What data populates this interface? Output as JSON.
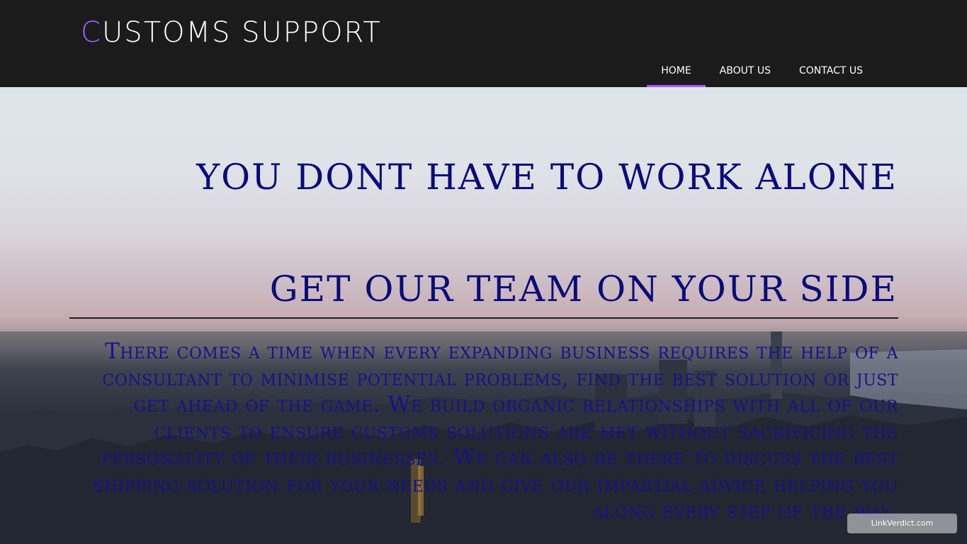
{
  "header": {
    "logo_first_letter": "C",
    "logo_rest": "USTOMS SUPPORT",
    "nav": [
      {
        "label": "HOME",
        "active": true
      },
      {
        "label": "ABOUT US",
        "active": false
      },
      {
        "label": "CONTACT US",
        "active": false
      }
    ]
  },
  "hero": {
    "title": "YOU DONT HAVE TO WORK ALONE",
    "subtitle": "GET OUR TEAM ON YOUR SIDE",
    "body": "There comes a time when every expanding business requires the help of a consultant to minimise potential problems, find the best solution or just get ahead of the game. We build organic relationships with all of our clients to ensure customs solutions are met without sacrificing the personality of their businesses. We can also be there to discuss the best shipping solution for your needs and give our impartial advice helping you along every step of the way."
  },
  "watermark": "LinkVerdict.com",
  "colors": {
    "accent": "#a35cff",
    "header_bg": "#1b1b1b",
    "hero_text": "#0a0a7a"
  }
}
